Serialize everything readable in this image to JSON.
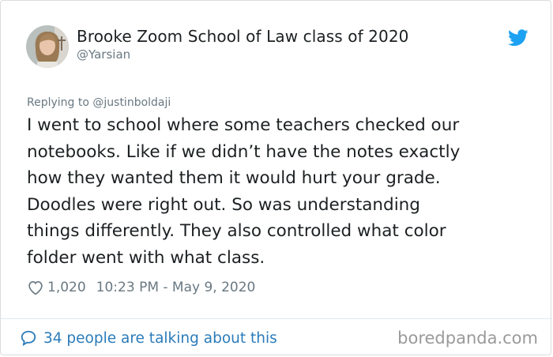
{
  "author": {
    "display_name": "Brooke Zoom School of Law class of 2020",
    "handle": "@Yarsian",
    "avatar_icon": "user-photo"
  },
  "reply": {
    "prefix": "Replying to",
    "to": "@justinboldaji"
  },
  "tweet": {
    "lines": [
      "I went to school where some teachers checked our",
      "notebooks. Like if we didn’t have the notes exactly",
      "how they wanted them it would hurt your grade.",
      "Doodles were right out. So was understanding",
      "things differently. They also controlled what color",
      "folder went with what class."
    ]
  },
  "meta": {
    "likes": "1,020",
    "timestamp": "10:23 PM - May 9, 2020"
  },
  "footer": {
    "talking": "34 people are talking about this",
    "watermark": "boredpanda.com"
  },
  "colors": {
    "twitter_blue": "#1da1f2",
    "link_blue": "#2b7bb9",
    "muted_text": "#697882",
    "main_text": "#1c2022"
  },
  "icons": {
    "brand": "twitter-bird-icon",
    "like": "heart-icon",
    "conversation": "speech-bubble-icon"
  }
}
